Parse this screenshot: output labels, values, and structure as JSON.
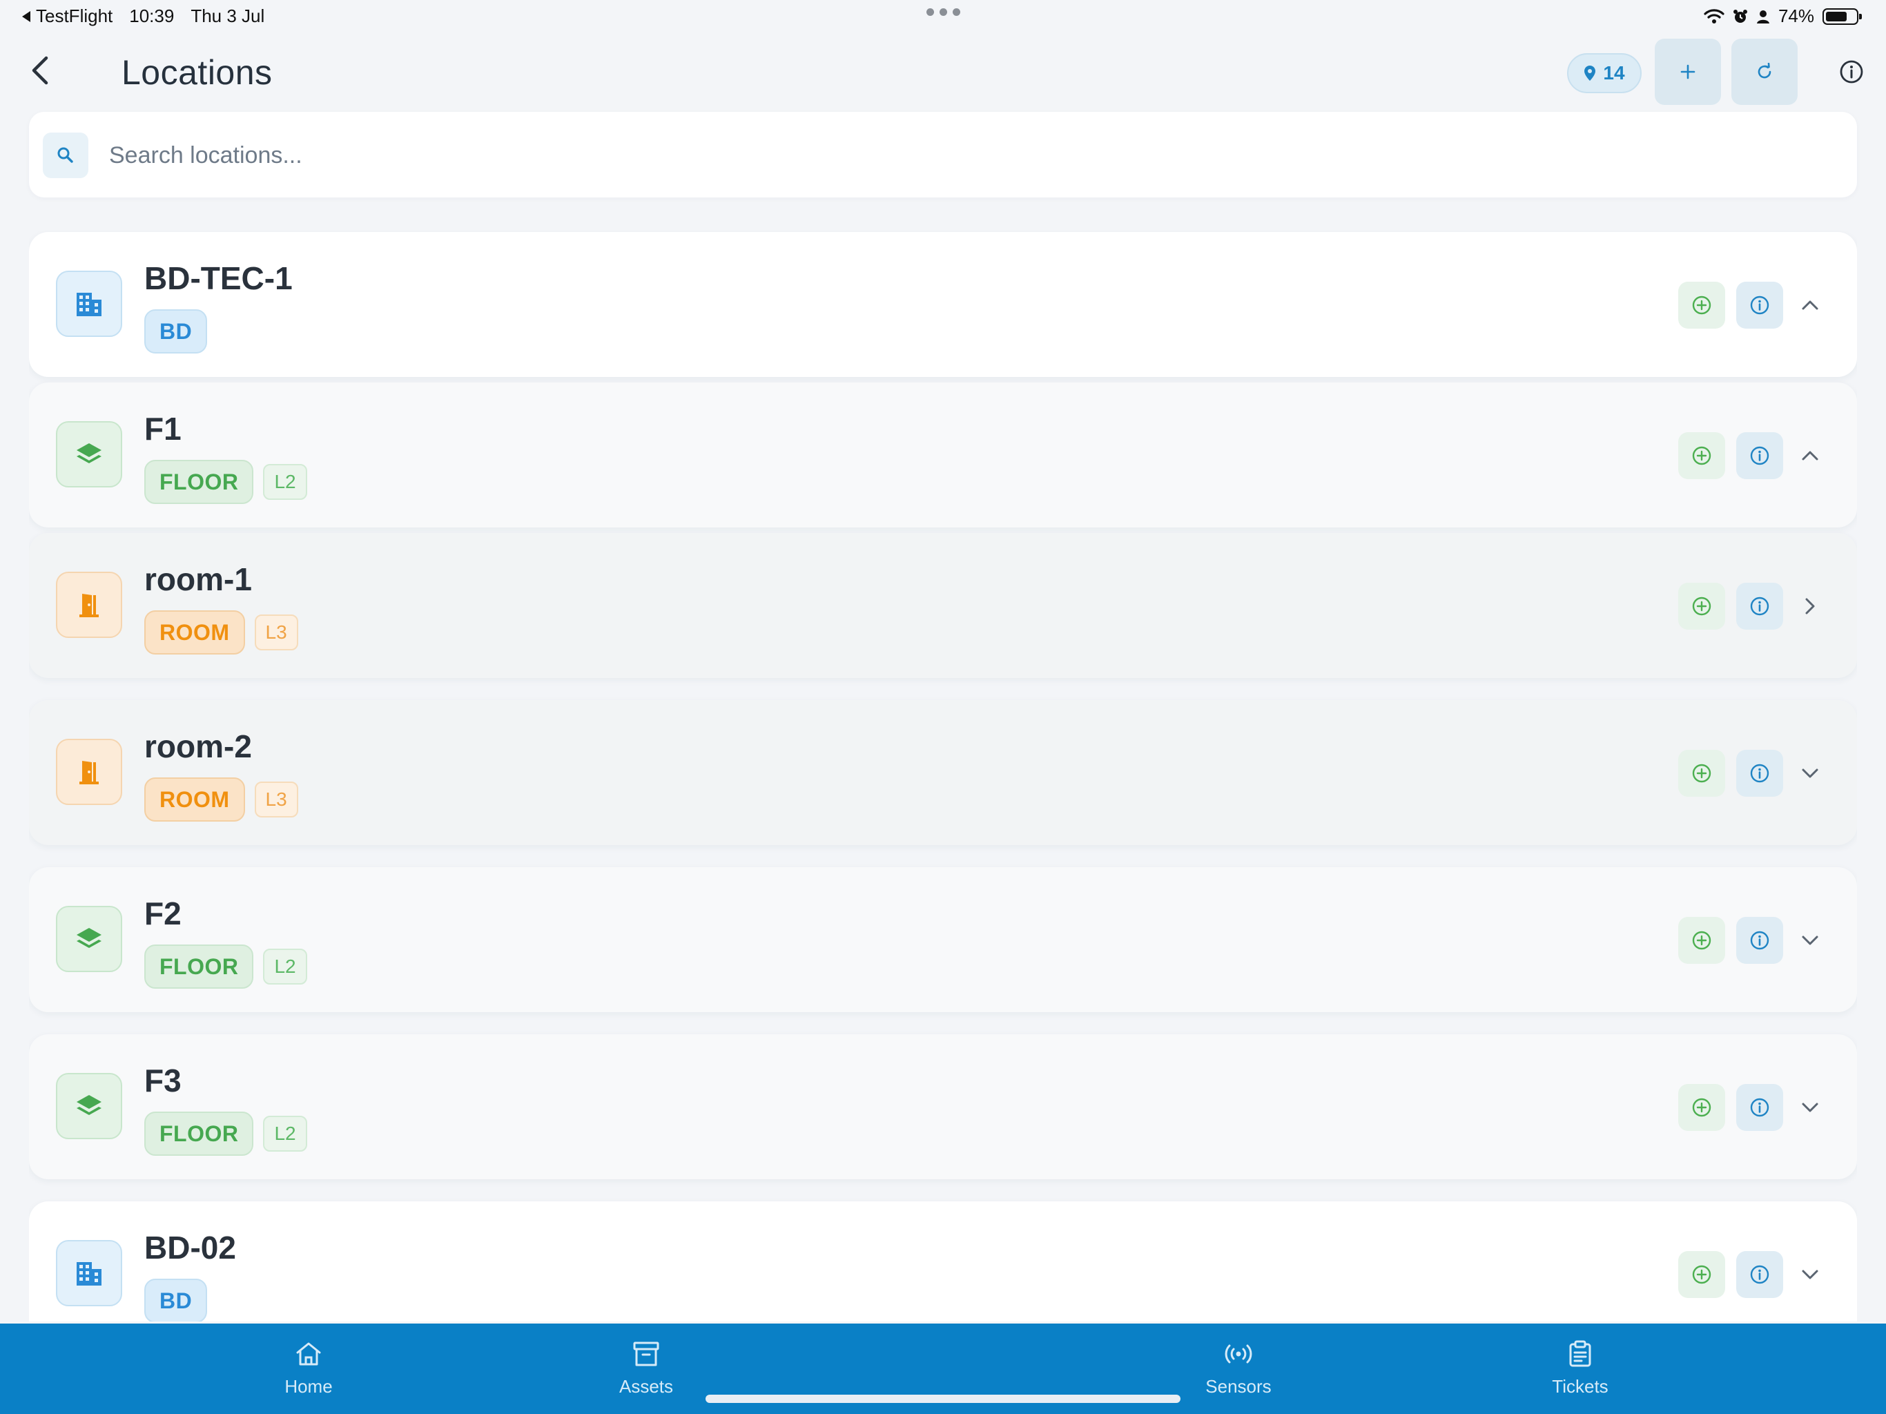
{
  "status_bar": {
    "back_app": "TestFlight",
    "time": "10:39",
    "date": "Thu 3 Jul",
    "battery": "74%",
    "battery_level": 0.74
  },
  "header": {
    "title": "Locations",
    "location_count": "14"
  },
  "search": {
    "placeholder": "Search locations..."
  },
  "locations": [
    {
      "name": "BD-TEC-1",
      "type": "BD",
      "level": "",
      "chevron": "up"
    },
    {
      "name": "F1",
      "type": "FLOOR",
      "level": "L2",
      "chevron": "up"
    },
    {
      "name": "room-1",
      "type": "ROOM",
      "level": "L3",
      "chevron": "right"
    },
    {
      "name": "room-2",
      "type": "ROOM",
      "level": "L3",
      "chevron": "down"
    },
    {
      "name": "F2",
      "type": "FLOOR",
      "level": "L2",
      "chevron": "down"
    },
    {
      "name": "F3",
      "type": "FLOOR",
      "level": "L2",
      "chevron": "down"
    },
    {
      "name": "BD-02",
      "type": "BD",
      "level": "",
      "chevron": "down"
    }
  ],
  "nav": {
    "home": "Home",
    "assets": "Assets",
    "sensors": "Sensors",
    "tickets": "Tickets"
  },
  "colors": {
    "primary": "#0a80c6",
    "building": "#2a8ad6",
    "floor": "#46a850",
    "room": "#f0900f"
  }
}
